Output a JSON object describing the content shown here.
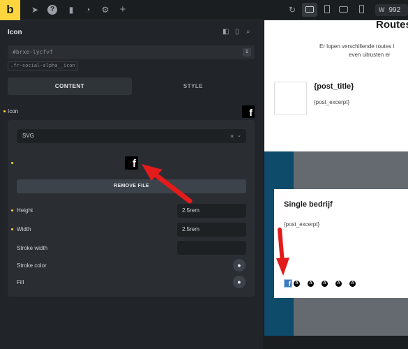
{
  "topbar": {
    "logo": "b",
    "icons": [
      "cursor-icon",
      "help-icon",
      "pages-icon",
      "history-icon",
      "settings-icon",
      "plus-icon",
      "undo-icon",
      "desktop-icon",
      "tablet-icon",
      "landscape-icon",
      "mobile-icon"
    ],
    "width_label": "W",
    "width_value": "992"
  },
  "panel": {
    "title": "Icon",
    "element_id": "#brxe-lycfvf",
    "id_badge": "1",
    "class_tag": ".fr-social-alpha__icon",
    "tabs": [
      {
        "label": "CONTENT",
        "active": true
      },
      {
        "label": "STYLE",
        "active": false
      }
    ],
    "icon_label": "Icon",
    "icon_type": "SVG",
    "remove_label": "REMOVE FILE",
    "fields": [
      {
        "label": "Height",
        "value": "2.5rem"
      },
      {
        "label": "Width",
        "value": "2.5rem"
      },
      {
        "label": "Stroke width",
        "value": ""
      }
    ],
    "stroke_color_label": "Stroke color",
    "fill_label": "Fill"
  },
  "preview": {
    "heading": "Routes",
    "desc_line1": "Er lopen verschillende routes l",
    "desc_line2": "even uitrusten er",
    "post_title": "{post_title}",
    "post_excerpt": "{post_excerpt}",
    "card_title": "Single bedrijf",
    "card_excerpt": "{post_excerpt}",
    "social_letter": "A",
    "fb_letter": "f"
  },
  "colors": {
    "accent": "#ffd53d",
    "arrow": "#e31b1b",
    "panel": "#212428",
    "preview_blue": "#0e4b6b"
  }
}
